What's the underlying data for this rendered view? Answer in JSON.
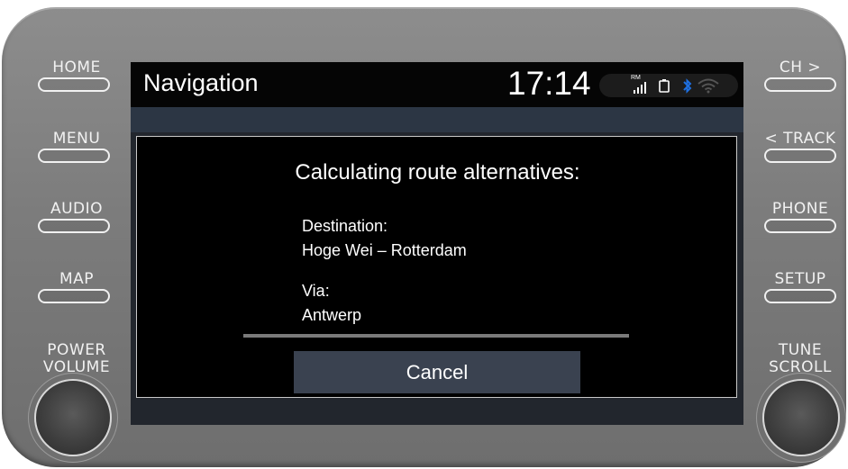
{
  "hardware": {
    "left_buttons": [
      {
        "label": "HOME"
      },
      {
        "label": "MENU"
      },
      {
        "label": "AUDIO"
      },
      {
        "label": "MAP"
      }
    ],
    "right_buttons": [
      {
        "label": "CH >"
      },
      {
        "label": "< TRACK"
      },
      {
        "label": "PHONE"
      },
      {
        "label": "SETUP"
      }
    ],
    "left_knob": {
      "label_line1": "POWER",
      "label_line2": "VOLUME"
    },
    "right_knob": {
      "label_line1": "TUNE",
      "label_line2": "SCROLL"
    }
  },
  "statusbar": {
    "title": "Navigation",
    "time": "17:14",
    "signal_badge": "RM",
    "icons": [
      "signal-icon",
      "phone-battery-icon",
      "bluetooth-icon",
      "wifi-icon"
    ],
    "bluetooth_color": "#1e6fe0"
  },
  "dialog": {
    "heading": "Calculating route alternatives:",
    "destination_label": "Destination:",
    "destination_value": "Hoge Wei – Rotterdam",
    "via_label": "Via:",
    "via_value": "Antwerp",
    "cancel_label": "Cancel"
  }
}
